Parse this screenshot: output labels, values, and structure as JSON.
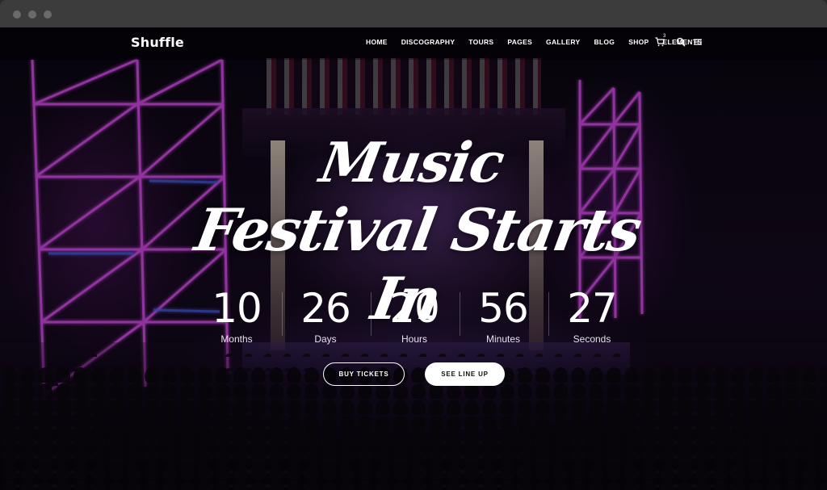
{
  "brand": {
    "logo": "Shuffle"
  },
  "nav": {
    "items": [
      "HOME",
      "DISCOGRAPHY",
      "TOURS",
      "PAGES",
      "GALLERY",
      "BLOG",
      "SHOP",
      "ELEMENTS"
    ],
    "cart_count": "3",
    "icons": [
      "cart-icon",
      "search-icon",
      "menu-icon"
    ]
  },
  "hero": {
    "title_line1": "Music",
    "title_line2": "Festival Starts In",
    "countdown": [
      {
        "value": "10",
        "label": "Months"
      },
      {
        "value": "26",
        "label": "Days"
      },
      {
        "value": "20",
        "label": "Hours"
      },
      {
        "value": "56",
        "label": "Minutes"
      },
      {
        "value": "27",
        "label": "Seconds"
      }
    ],
    "buttons": {
      "primary": "BUY TICKETS",
      "secondary": "SEE LINE UP"
    }
  },
  "colors": {
    "accent_neon": "#c43bd8",
    "text": "#ffffff",
    "button_fill": "#ffffff"
  }
}
